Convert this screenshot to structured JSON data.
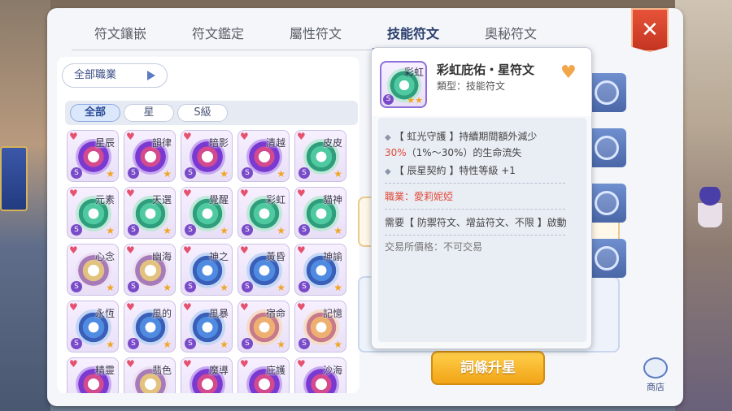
{
  "tabs": [
    "符文鑲嵌",
    "符文鑑定",
    "屬性符文",
    "技能符文",
    "奧秘符文"
  ],
  "active_tab": "技能符文",
  "close_label": "✕",
  "job_filter": "全部職業",
  "filters": [
    "全部",
    "星",
    "S級"
  ],
  "grid": [
    {
      "name": "星辰",
      "style": "red"
    },
    {
      "name": "韻律",
      "style": "red"
    },
    {
      "name": "暗影",
      "style": "red"
    },
    {
      "name": "清越",
      "style": "red"
    },
    {
      "name": "皮皮",
      "style": "green"
    },
    {
      "name": "元素",
      "style": "green"
    },
    {
      "name": "天選",
      "style": "green"
    },
    {
      "name": "覺醒",
      "style": "green"
    },
    {
      "name": "彩虹",
      "style": "green"
    },
    {
      "name": "貓神",
      "style": "green"
    },
    {
      "name": "心念",
      "style": "gold"
    },
    {
      "name": "幽海",
      "style": "gold"
    },
    {
      "name": "神之",
      "style": "blue"
    },
    {
      "name": "黃昏",
      "style": "blue"
    },
    {
      "name": "神諭",
      "style": "blue"
    },
    {
      "name": "永恆",
      "style": "blue"
    },
    {
      "name": "風的",
      "style": "blue"
    },
    {
      "name": "風暴",
      "style": "blue"
    },
    {
      "name": "宿命",
      "style": "orange"
    },
    {
      "name": "記憶",
      "style": "orange"
    },
    {
      "name": "精靈",
      "style": "red"
    },
    {
      "name": "翡色",
      "style": "gold"
    },
    {
      "name": "魔導",
      "style": "red"
    },
    {
      "name": "庇護",
      "style": "red"
    },
    {
      "name": "沙海",
      "style": "red"
    }
  ],
  "tooltip": {
    "icon_name": "彩虹",
    "title": "彩虹庇佑・星符文",
    "type": "類型：技能符文",
    "effect1_pre": "【 虹光守護 】持續期間額外減少",
    "effect1_hl": "30%",
    "effect1_post": "（1%～30%）的生命流失",
    "effect2": "【 辰星契約 】特性等級 +1",
    "job": "職業：愛莉妮婭",
    "requirement": "需要【 防禦符文、增益符文、不限 】啟動",
    "trade": "交易所價格：不可交易"
  },
  "bg_peek": "%）",
  "upgrade_label": "詞條升星",
  "shop_label": "商店",
  "colors": {
    "accent": "#3d5aa0",
    "highlight": "#e14b3b",
    "button": "#f2a417"
  }
}
